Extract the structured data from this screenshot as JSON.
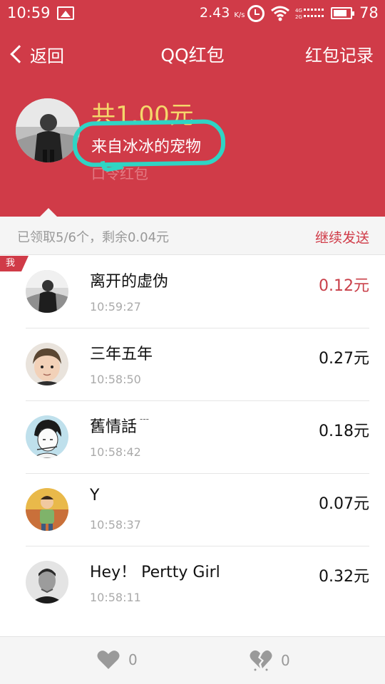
{
  "status_bar": {
    "time": "10:59",
    "speed": "2.43",
    "speed_unit": "K/s",
    "battery": "78"
  },
  "header": {
    "back_label": "返回",
    "title": "QQ红包",
    "records_label": "红包记录",
    "total_amount": "共1.00元",
    "sender": "来自冰冰的宠物",
    "type_label": "口令红包",
    "highlight_color": "#2fd4c4",
    "background_color": "#d03b48"
  },
  "summary": {
    "text": "已领取5/6个，剩余0.04元",
    "continue_label": "继续发送"
  },
  "me_badge": "我",
  "recipients": [
    {
      "name": "离开的虚伪",
      "time": "10:59:27",
      "amount": "0.12元",
      "is_me": true,
      "avatar": "avatar-bw-man"
    },
    {
      "name": "三年五年",
      "time": "10:58:50",
      "amount": "0.27元",
      "is_me": false,
      "avatar": "avatar-child"
    },
    {
      "name": "舊情話",
      "time": "10:58:42",
      "amount": "0.18元",
      "is_me": false,
      "avatar": "avatar-anime"
    },
    {
      "name": "Y",
      "time": "10:58:37",
      "amount": "0.07元",
      "is_me": false,
      "avatar": "avatar-cartoon"
    },
    {
      "name": "Hey！ Pertty Girl",
      "time": "10:58:11",
      "amount": "0.32元",
      "is_me": false,
      "avatar": "avatar-man-gray"
    }
  ],
  "bottom_bar": {
    "like_count": "0",
    "broken_heart_count": "0"
  }
}
